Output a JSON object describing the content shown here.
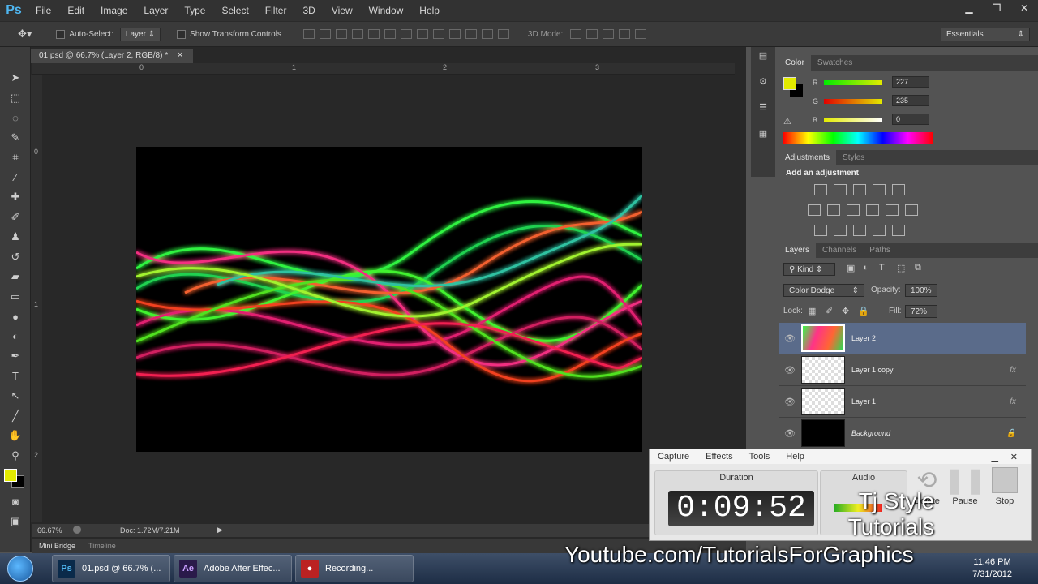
{
  "app": {
    "logo": "Ps"
  },
  "menu": [
    "File",
    "Edit",
    "Image",
    "Layer",
    "Type",
    "Select",
    "Filter",
    "3D",
    "View",
    "Window",
    "Help"
  ],
  "window_controls": [
    "minimize-icon",
    "restore-icon",
    "close-icon"
  ],
  "options": {
    "auto_select_label": "Auto-Select:",
    "auto_select_value": "Layer",
    "show_transform_label": "Show Transform Controls",
    "mode_label": "3D Mode:",
    "workspace": "Essentials"
  },
  "document": {
    "tab_title": "01.psd @ 66.7% (Layer 2, RGB/8) *",
    "ruler_top": [
      "0",
      "1",
      "2",
      "3"
    ],
    "ruler_left": [
      "0",
      "1",
      "2"
    ],
    "zoom": "66.67%",
    "doc_size": "Doc: 1.72M/7.21M"
  },
  "bottom_tabs": [
    "Mini Bridge",
    "Timeline"
  ],
  "color_panel": {
    "tabs": [
      "Color",
      "Swatches"
    ],
    "r_label": "R",
    "g_label": "G",
    "b_label": "B",
    "r": "227",
    "g": "235",
    "b": "0",
    "fg_color": "#e3eb00"
  },
  "adjustments_panel": {
    "tabs": [
      "Adjustments",
      "Styles"
    ],
    "heading": "Add an adjustment"
  },
  "layers_panel": {
    "tabs": [
      "Layers",
      "Channels",
      "Paths"
    ],
    "filter_kind": "Kind",
    "blend_mode": "Color Dodge",
    "opacity_label": "Opacity:",
    "opacity": "100%",
    "lock_label": "Lock:",
    "fill_label": "Fill:",
    "fill": "72%",
    "layers": [
      {
        "name": "Layer 2",
        "selected": true,
        "fx": false
      },
      {
        "name": "Layer 1 copy",
        "selected": false,
        "fx": true,
        "fx_label": "fx"
      },
      {
        "name": "Layer 1",
        "selected": false,
        "fx": true,
        "fx_label": "fx"
      },
      {
        "name": "Background",
        "selected": false,
        "fx": false
      }
    ]
  },
  "recorder": {
    "menu": [
      "Capture",
      "Effects",
      "Tools",
      "Help"
    ],
    "duration_label": "Duration",
    "duration": "0:09:52",
    "audio_label": "Audio",
    "buttons": [
      "Delete",
      "Pause",
      "Stop"
    ]
  },
  "watermark": {
    "line1": "Tj Style",
    "line2": "Tutorials",
    "url": "Youtube.com/TutorialsForGraphics"
  },
  "taskbar": {
    "items": [
      {
        "icon_text": "Ps",
        "label": "01.psd @ 66.7% (..."
      },
      {
        "icon_text": "Ae",
        "label": "Adobe After Effec..."
      },
      {
        "icon_text": "",
        "label": "Recording..."
      }
    ],
    "time": "11:46 PM",
    "date": "7/31/2012"
  }
}
